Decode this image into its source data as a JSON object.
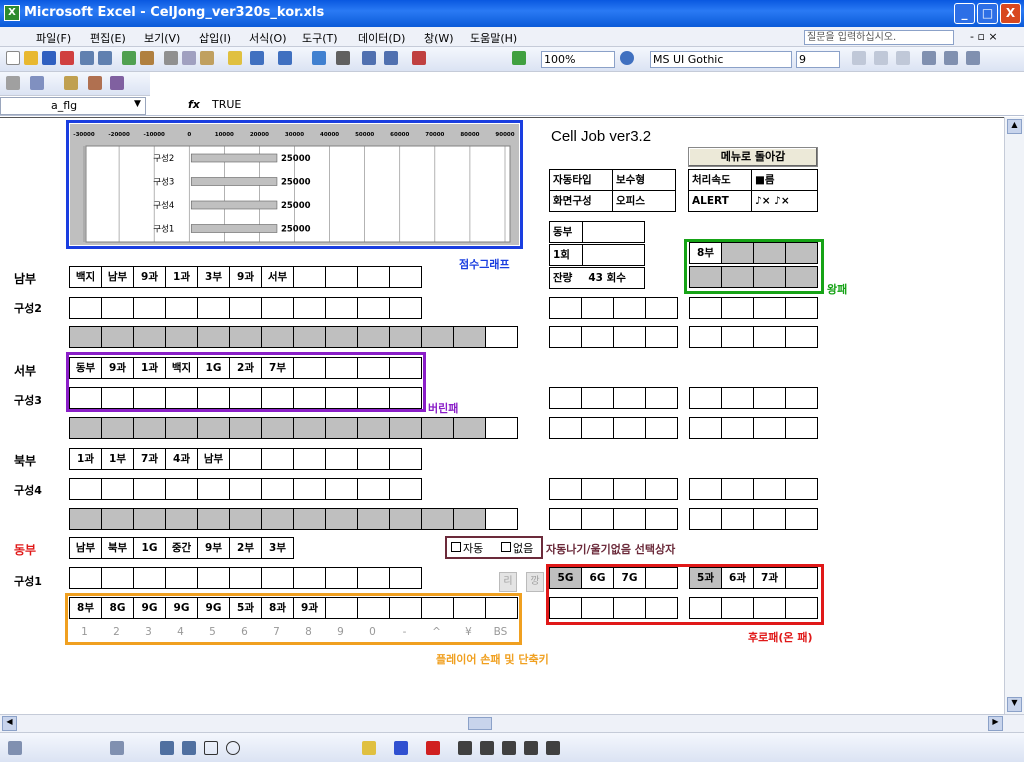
{
  "window": {
    "title": "Microsoft Excel - CelJong_ver320s_kor.xls",
    "icon": "excel-icon",
    "buttons": [
      "_",
      "□",
      "X"
    ]
  },
  "menu": {
    "items": [
      "파일(F)",
      "편집(E)",
      "보기(V)",
      "삽입(I)",
      "서식(O)",
      "도구(T)",
      "데이터(D)",
      "창(W)",
      "도움말(H)"
    ],
    "help_placeholder": "질문을 입력하십시오.",
    "doc_controls": "- ▫ ×"
  },
  "toolbar": {
    "zoom": "100%",
    "font": "MS UI Gothic",
    "size": "9"
  },
  "formula": {
    "name_box": "a_flg",
    "fx": "fx",
    "value": "TRUE"
  },
  "chart": {
    "axis_ticks": [
      "-30000",
      "-20000",
      "-10000",
      "0",
      "10000",
      "20000",
      "30000",
      "40000",
      "50000",
      "60000",
      "70000",
      "80000",
      "90000"
    ]
  },
  "chart_data": {
    "type": "bar",
    "categories": [
      "구성2",
      "구성3",
      "구성4",
      "구성1"
    ],
    "values": [
      25000,
      25000,
      25000,
      25000
    ],
    "xlim": [
      -30000,
      90000
    ],
    "grid": true
  },
  "header": {
    "app_title": "Cell Job ver3.2",
    "menu_button": "메뉴로 돌아감"
  },
  "info": {
    "auto_type": "자동타입",
    "auto_type_val": "보수형",
    "speed": "처리속도",
    "speed_val": "■름",
    "screen": "화면구성",
    "screen_val": "오피스",
    "alert": "ALERT",
    "alert_val": "♪× ♪×",
    "wind": "동부",
    "round": "1회",
    "remain": "잔량",
    "remain_val": "43 회수"
  },
  "labels": {
    "score_graph": "점수그래프",
    "king": "왕패",
    "discard": "버린패",
    "auto_select": "자동나기/울기없음 선택상자",
    "player_hand": "플레이어 손패 및 단축키",
    "back_tiles": "후로패(온 패)"
  },
  "players": {
    "south": "남부",
    "south_sub": "구성2",
    "west": "서부",
    "west_sub": "구성3",
    "north": "북부",
    "north_sub": "구성4",
    "east": "동부",
    "east_sub": "구성1"
  },
  "rows": {
    "south_discard": [
      "백지",
      "남부",
      "9과",
      "1과",
      "3부",
      "9과",
      "서부",
      "",
      "",
      "",
      "",
      ""
    ],
    "west_discard": [
      "동부",
      "9과",
      "1과",
      "백지",
      "1G",
      "2과",
      "7부",
      "",
      "",
      "",
      "",
      ""
    ],
    "north_discard": [
      "1과",
      "1부",
      "7과",
      "4과",
      "남부",
      "",
      "",
      "",
      "",
      "",
      "",
      ""
    ],
    "east_discard": [
      "남부",
      "북부",
      "1G",
      "중간",
      "9부",
      "2부",
      "3부",
      "",
      "",
      "",
      "",
      ""
    ],
    "hand": [
      "8부",
      "8G",
      "9G",
      "9G",
      "9G",
      "5과",
      "8과",
      "9과",
      "",
      "",
      "",
      "",
      "",
      ""
    ],
    "meld_row1": [
      "5G",
      "6G",
      "7G",
      ""
    ],
    "meld_row1b": [
      "5과",
      "6과",
      "7과",
      ""
    ],
    "king_top": [
      "8부",
      "",
      "",
      ""
    ]
  },
  "checkboxes": {
    "auto": "자동",
    "none": "없음"
  },
  "side_buttons": {
    "ri": "리",
    "kan": "깡"
  },
  "shortcut_keys": [
    "1",
    "2",
    "3",
    "4",
    "5",
    "6",
    "7",
    "8",
    "9",
    "0",
    "-",
    "^",
    "¥",
    "BS"
  ],
  "colors": {
    "blue": "#1a3ee0",
    "green": "#16a316",
    "purple": "#8a1ec8",
    "orange": "#f0a020",
    "red": "#e01818",
    "maroon": "#6b2a3a",
    "east_label": "#e01818",
    "gray_cell": "#bfbfbf"
  }
}
